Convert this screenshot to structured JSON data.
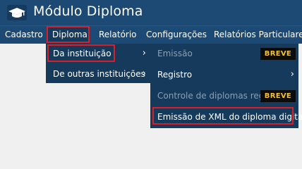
{
  "app": {
    "title": "Módulo Diploma"
  },
  "menubar": {
    "items": [
      {
        "label": "Cadastro"
      },
      {
        "label": "Diploma"
      },
      {
        "label": "Relatório"
      },
      {
        "label": "Configurações"
      },
      {
        "label": "Relatórios Particulares"
      }
    ]
  },
  "diploma_menu": {
    "items": [
      {
        "label": "Da instituição"
      },
      {
        "label": "De outras instituições"
      }
    ]
  },
  "instituicao_submenu": {
    "items": [
      {
        "label": "Emissão",
        "badge": "BREVE"
      },
      {
        "label": "Registro"
      },
      {
        "label": "Controle de diplomas registrados",
        "badge": "BREVE"
      },
      {
        "label": "Emissão de XML do diploma digital"
      }
    ]
  },
  "icons": {
    "submenu_arrow": "chevron-right-icon",
    "logo": "graduation-cap-icon"
  },
  "colors": {
    "nav": "#1c4a74",
    "dropdown": "#163a5c",
    "highlight": "#d9202a",
    "badge_text": "#f2c230"
  }
}
